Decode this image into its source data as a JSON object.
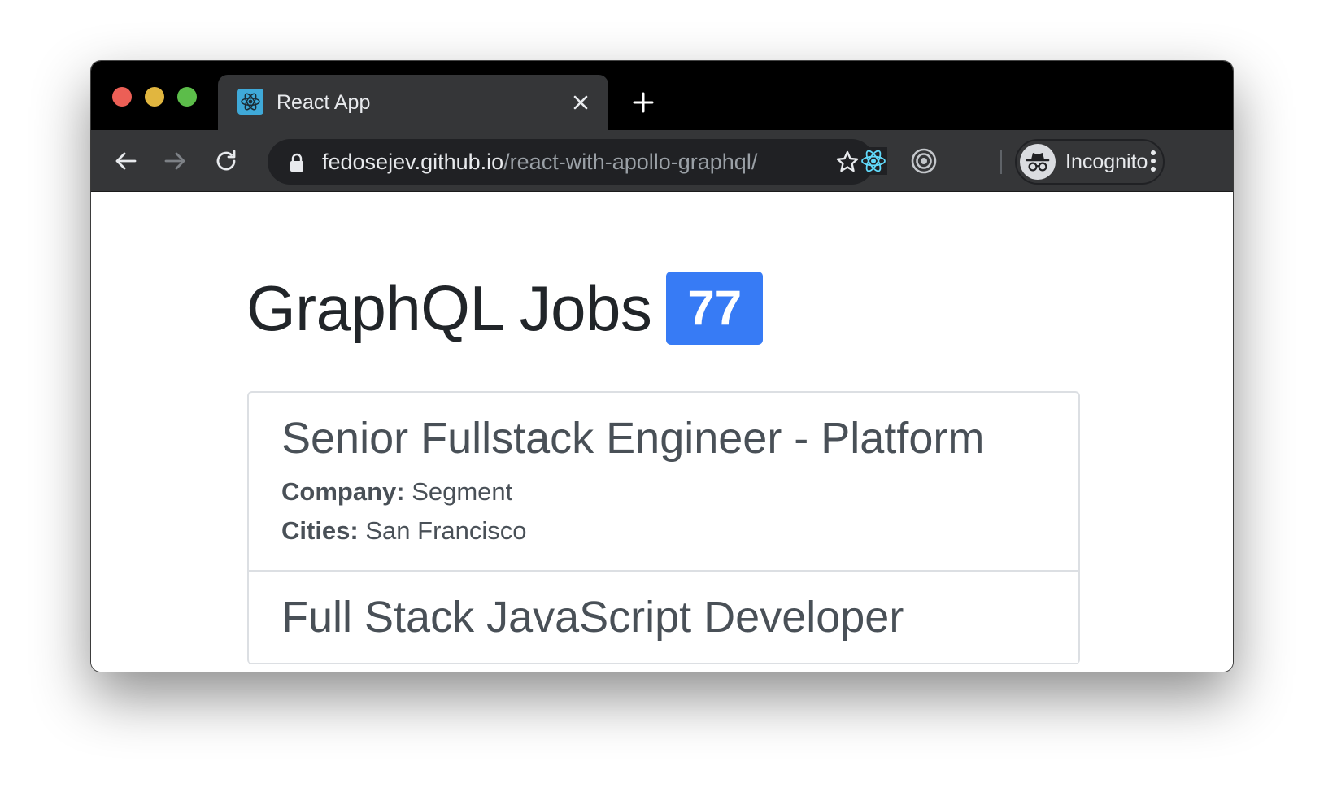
{
  "browser": {
    "tab": {
      "title": "React App",
      "favicon": "react-icon"
    },
    "toolbar": {
      "back_icon": "back-arrow-icon",
      "forward_icon": "forward-arrow-icon",
      "reload_icon": "reload-icon",
      "url_host": "fedosejev.github.io",
      "url_path": "/react-with-apollo-graphql/",
      "profile_label": "Incognito"
    },
    "colors": {
      "titlebar": "#000000",
      "toolbar": "#353638",
      "omnibox": "#202124",
      "accent": "#377bf5"
    }
  },
  "page": {
    "title": "GraphQL Jobs",
    "count": "77",
    "jobs": [
      {
        "title": "Senior Fullstack Engineer - Platform",
        "company_label": "Company:",
        "company": "Segment",
        "cities_label": "Cities:",
        "cities": "San Francisco"
      },
      {
        "title": "Full Stack JavaScript Developer"
      }
    ]
  }
}
